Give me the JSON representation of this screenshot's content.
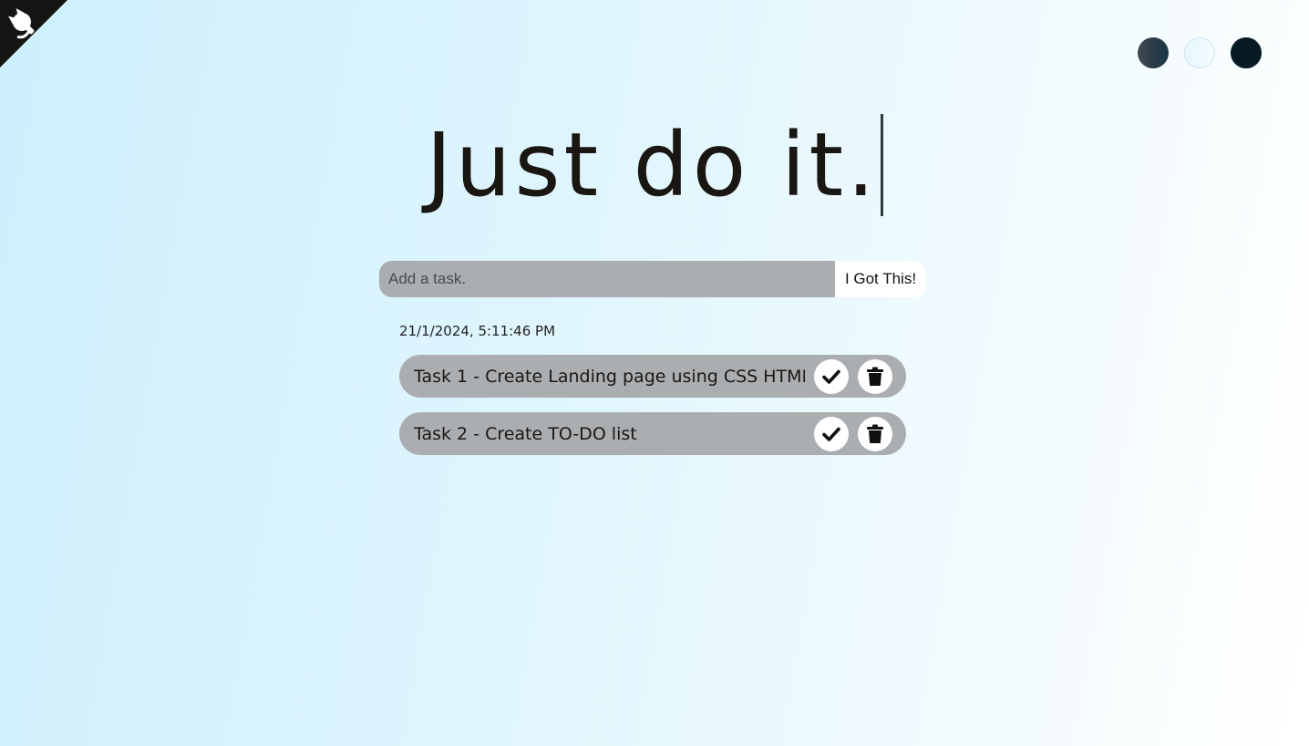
{
  "header": {
    "title": "Just do it."
  },
  "themes": [
    {
      "name": "standard",
      "color": "#2c3d48"
    },
    {
      "name": "light",
      "color": "#eef9fd"
    },
    {
      "name": "darker",
      "color": "#061a24"
    }
  ],
  "form": {
    "input_value": "",
    "input_placeholder": "Add a task.",
    "submit_label": "I Got This!"
  },
  "datetime": "21/1/2024, 5:11:46 PM",
  "tasks": [
    {
      "text": "Task 1 - Create Landing page using CSS HTML"
    },
    {
      "text": "Task 2 - Create TO-DO list"
    }
  ],
  "colors": {
    "accent_task_bg": "#abaeb1",
    "text": "#1a1612",
    "button_bg": "#ffffff"
  },
  "icons": {
    "corner": "github-icon",
    "check": "check-icon",
    "delete": "trash-icon"
  }
}
